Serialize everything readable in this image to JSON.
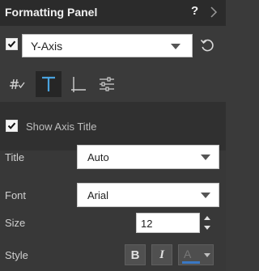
{
  "header": {
    "title": "Formatting Panel",
    "help_label": "?"
  },
  "axis": {
    "checked": true,
    "selected": "Y-Axis"
  },
  "tabs": [
    {
      "icon": "number-format-icon",
      "active": false
    },
    {
      "icon": "text-format-icon",
      "active": true
    },
    {
      "icon": "axis-icon",
      "active": false
    },
    {
      "icon": "settings-sliders-icon",
      "active": false
    }
  ],
  "content": {
    "show_axis_title": {
      "label": "Show Axis Title",
      "checked": true
    },
    "title": {
      "label": "Title",
      "value": "Auto"
    },
    "font": {
      "label": "Font",
      "value": "Arial"
    },
    "size": {
      "label": "Size",
      "value": "12"
    },
    "style": {
      "label": "Style",
      "bold_label": "B",
      "italic_label": "I",
      "color_label": "A",
      "color": "#3a78c4"
    }
  },
  "colors": {
    "accent": "#4aa3df",
    "panel_bg": "#3a3a3a",
    "header_bg": "#2b2b2b"
  }
}
